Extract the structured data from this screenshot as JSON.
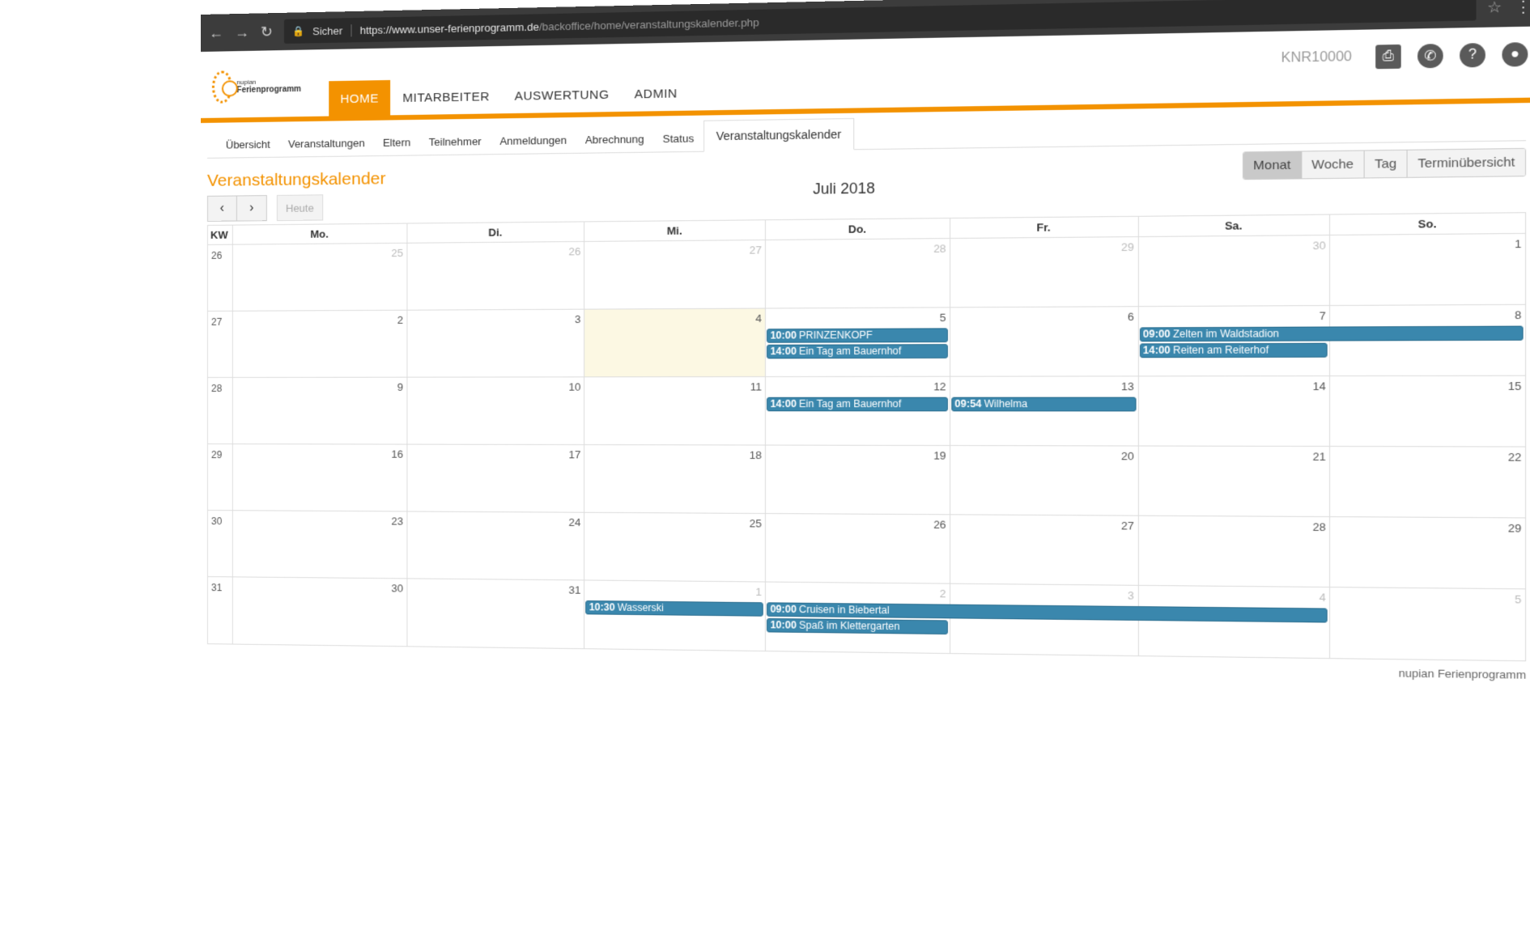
{
  "browser": {
    "secure_label": "Sicher",
    "url_host": "https://www.unser-ferienprogramm.de",
    "url_path": "/backoffice/home/veranstaltungskalender.php"
  },
  "header": {
    "logo_line1": "nupian",
    "logo_line2": "Ferienprogramm",
    "user_id": "KNR10000",
    "nav": [
      {
        "label": "HOME",
        "active": true
      },
      {
        "label": "MITARBEITER",
        "active": false
      },
      {
        "label": "AUSWERTUNG",
        "active": false
      },
      {
        "label": "ADMIN",
        "active": false
      }
    ]
  },
  "subnav": [
    {
      "label": "Übersicht",
      "active": false
    },
    {
      "label": "Veranstaltungen",
      "active": false
    },
    {
      "label": "Eltern",
      "active": false
    },
    {
      "label": "Teilnehmer",
      "active": false
    },
    {
      "label": "Anmeldungen",
      "active": false
    },
    {
      "label": "Abrechnung",
      "active": false
    },
    {
      "label": "Status",
      "active": false
    },
    {
      "label": "Veranstaltungskalender",
      "active": true
    }
  ],
  "page": {
    "title": "Veranstaltungskalender",
    "month_title": "Juli 2018",
    "today_label": "Heute",
    "view_buttons": [
      {
        "label": "Monat",
        "active": true
      },
      {
        "label": "Woche",
        "active": false
      },
      {
        "label": "Tag",
        "active": false
      },
      {
        "label": "Terminübersicht",
        "active": false
      }
    ],
    "footer": "nupian Ferienprogramm"
  },
  "calendar": {
    "kw_label": "KW",
    "weekdays": [
      "Mo.",
      "Di.",
      "Mi.",
      "Do.",
      "Fr.",
      "Sa.",
      "So."
    ],
    "weeks": [
      {
        "kw": "26",
        "days": [
          {
            "d": "25",
            "other": true
          },
          {
            "d": "26",
            "other": true
          },
          {
            "d": "27",
            "other": true
          },
          {
            "d": "28",
            "other": true
          },
          {
            "d": "29",
            "other": true
          },
          {
            "d": "30",
            "other": true
          },
          {
            "d": "1",
            "other": false
          }
        ]
      },
      {
        "kw": "27",
        "days": [
          {
            "d": "2",
            "other": false
          },
          {
            "d": "3",
            "other": false
          },
          {
            "d": "4",
            "other": false,
            "today": true
          },
          {
            "d": "5",
            "other": false
          },
          {
            "d": "6",
            "other": false
          },
          {
            "d": "7",
            "other": false
          },
          {
            "d": "8",
            "other": false
          }
        ]
      },
      {
        "kw": "28",
        "days": [
          {
            "d": "9",
            "other": false
          },
          {
            "d": "10",
            "other": false
          },
          {
            "d": "11",
            "other": false
          },
          {
            "d": "12",
            "other": false
          },
          {
            "d": "13",
            "other": false
          },
          {
            "d": "14",
            "other": false
          },
          {
            "d": "15",
            "other": false
          }
        ]
      },
      {
        "kw": "29",
        "days": [
          {
            "d": "16",
            "other": false
          },
          {
            "d": "17",
            "other": false
          },
          {
            "d": "18",
            "other": false
          },
          {
            "d": "19",
            "other": false
          },
          {
            "d": "20",
            "other": false
          },
          {
            "d": "21",
            "other": false
          },
          {
            "d": "22",
            "other": false
          }
        ]
      },
      {
        "kw": "30",
        "days": [
          {
            "d": "23",
            "other": false
          },
          {
            "d": "24",
            "other": false
          },
          {
            "d": "25",
            "other": false
          },
          {
            "d": "26",
            "other": false
          },
          {
            "d": "27",
            "other": false
          },
          {
            "d": "28",
            "other": false
          },
          {
            "d": "29",
            "other": false
          }
        ]
      },
      {
        "kw": "31",
        "days": [
          {
            "d": "30",
            "other": false
          },
          {
            "d": "31",
            "other": false
          },
          {
            "d": "1",
            "other": true
          },
          {
            "d": "2",
            "other": true
          },
          {
            "d": "3",
            "other": true
          },
          {
            "d": "4",
            "other": true
          },
          {
            "d": "5",
            "other": true
          }
        ]
      }
    ],
    "events": [
      {
        "week": 1,
        "start": 3,
        "span": 1,
        "row": 0,
        "time": "10:00",
        "title": "PRINZENKOPF"
      },
      {
        "week": 1,
        "start": 3,
        "span": 1,
        "row": 1,
        "time": "14:00",
        "title": "Ein Tag am Bauernhof"
      },
      {
        "week": 1,
        "start": 5,
        "span": 2,
        "row": 0,
        "time": "09:00",
        "title": "Zelten im Waldstadion"
      },
      {
        "week": 1,
        "start": 5,
        "span": 1,
        "row": 1,
        "time": "14:00",
        "title": "Reiten am Reiterhof"
      },
      {
        "week": 2,
        "start": 3,
        "span": 1,
        "row": 0,
        "time": "14:00",
        "title": "Ein Tag am Bauernhof"
      },
      {
        "week": 2,
        "start": 4,
        "span": 1,
        "row": 0,
        "time": "09:54",
        "title": "Wilhelma"
      },
      {
        "week": 5,
        "start": 2,
        "span": 1,
        "row": 0,
        "time": "10:30",
        "title": "Wasserski"
      },
      {
        "week": 5,
        "start": 3,
        "span": 3,
        "row": 0,
        "time": "09:00",
        "title": "Cruisen in Biebertal"
      },
      {
        "week": 5,
        "start": 3,
        "span": 1,
        "row": 1,
        "time": "10:00",
        "title": "Spaß im Klettergarten"
      }
    ]
  }
}
